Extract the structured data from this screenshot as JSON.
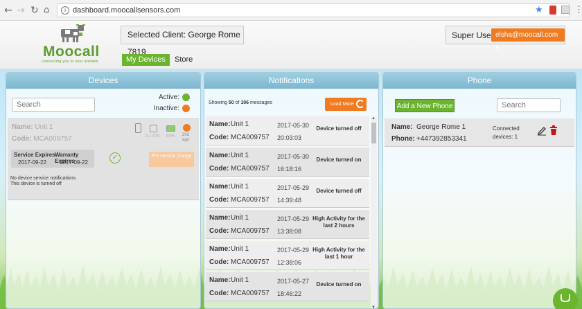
{
  "browser": {
    "url": "dashboard.moocallsensors.com",
    "back_icon": "arrow-left-icon",
    "forward_icon": "arrow-right-icon",
    "reload_icon": "reload-icon",
    "home_icon": "home-icon"
  },
  "header": {
    "logo_text": "Moocall",
    "logo_tagline": "connecting you to your animals",
    "selected_client": "Selected Client: George Rome 7819",
    "tabs": [
      {
        "label": "My Devices",
        "active": true
      },
      {
        "label": "Store",
        "active": false
      }
    ],
    "user_role": "Super User",
    "user_email": "elsha@moocall.com ▾"
  },
  "colors": {
    "brand_green": "#6ab42e",
    "accent_orange": "#f07b20",
    "panel_header": "#8cc3d9"
  },
  "devices": {
    "title": "Devices",
    "search_placeholder": "Search",
    "active_label": "Active:",
    "inactive_label": "Inactive:",
    "card": {
      "name_key": "Name:",
      "name_value": "Unit 1",
      "code_key": "Code:",
      "code_value": "MCA009757",
      "firmware": "0.1.079",
      "battery": "93%",
      "last_seen": "20d ago",
      "service_expires_label": "Service Expires",
      "service_expires_date": "2017-09-22",
      "warranty_expires_label": "Warranty Expires",
      "warranty_expires_date": "2017-09-22",
      "pre_service_label": "Pre service charge",
      "notifications_text": "No device service notifications",
      "status_text": "This device is turned off"
    }
  },
  "notifications": {
    "title": "Notifications",
    "showing_prefix": "Showing ",
    "showing_count": "50",
    "showing_mid": " of ",
    "showing_total": "106",
    "showing_suffix": " messages",
    "load_more": "Load More",
    "name_key": "Name:",
    "code_key": "Code:",
    "items": [
      {
        "name": "Unit 1",
        "code": "MCA009757",
        "date": "2017-05-30",
        "time": "20:03:03",
        "message": "Device turned off"
      },
      {
        "name": "Unit 1",
        "code": "MCA009757",
        "date": "2017-05-30",
        "time": "16:18:16",
        "message": "Device turned on"
      },
      {
        "name": "Unit 1",
        "code": "MCA009757",
        "date": "2017-05-29",
        "time": "14:39:48",
        "message": "Device turned off"
      },
      {
        "name": "Unit 1",
        "code": "MCA009757",
        "date": "2017-05-29",
        "time": "13:38:08",
        "message": "High Activity for the last 2 hours"
      },
      {
        "name": "Unit 1",
        "code": "MCA009757",
        "date": "2017-05-29",
        "time": "12:38:06",
        "message": "High Activity for the last 1 hour"
      },
      {
        "name": "Unit 1",
        "code": "MCA009757",
        "date": "2017-05-27",
        "time": "18:46:22",
        "message": "Device turned on"
      }
    ]
  },
  "phone": {
    "title": "Phone",
    "add_button": "Add a New Phone",
    "search_placeholder": "Search",
    "card": {
      "name_key": "Name:",
      "name_value": "George Rome 1",
      "phone_key": "Phone:",
      "phone_value": "+447392853341",
      "connected_label": "Connected",
      "devices_label": "devices: 1"
    }
  }
}
